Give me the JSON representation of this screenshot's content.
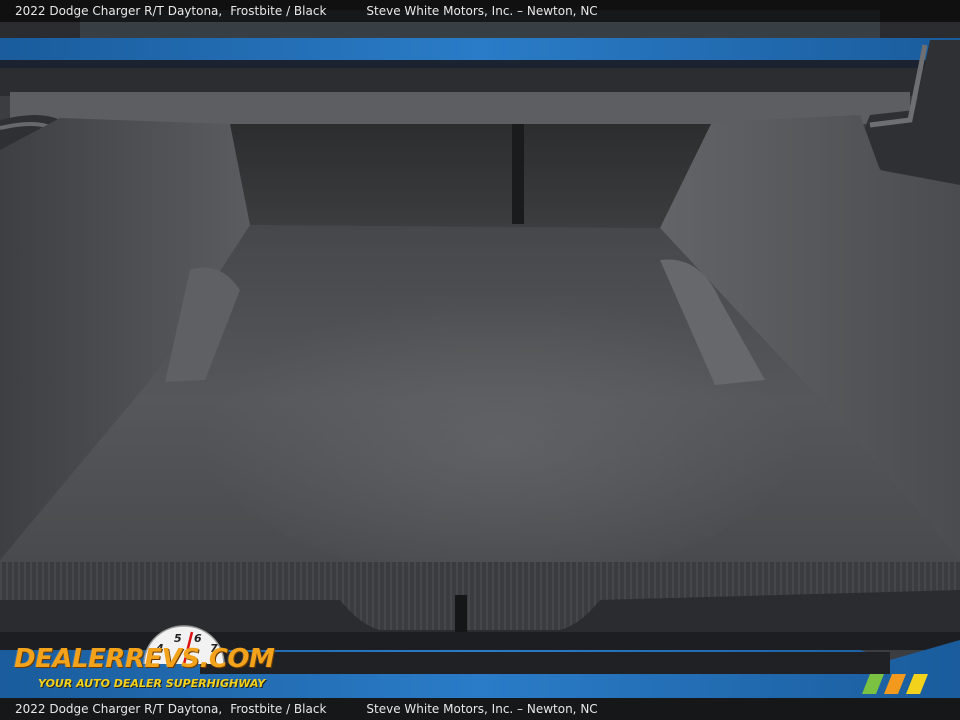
{
  "caption": {
    "vehicle": "2022 Dodge Charger R/T Daytona,",
    "color": "Frostbite / Black",
    "dealer": "Steve White Motors, Inc. – Newton, NC"
  },
  "watermark": {
    "logo_text": "DEALERREVS.COM",
    "tagline": "YOUR AUTO DEALER SUPERHIGHWAY",
    "gauge_digits": [
      "4",
      "5",
      "6",
      "7"
    ]
  },
  "colors": {
    "body_paint": "#1f6fb8",
    "carpet": "#4b4d50",
    "logo_orange": "#f2a21b",
    "tagline_yellow": "#f5d21a",
    "stripe_green": "#7cc242",
    "stripe_orange": "#f39a1e",
    "stripe_yellow": "#f2d21b"
  }
}
